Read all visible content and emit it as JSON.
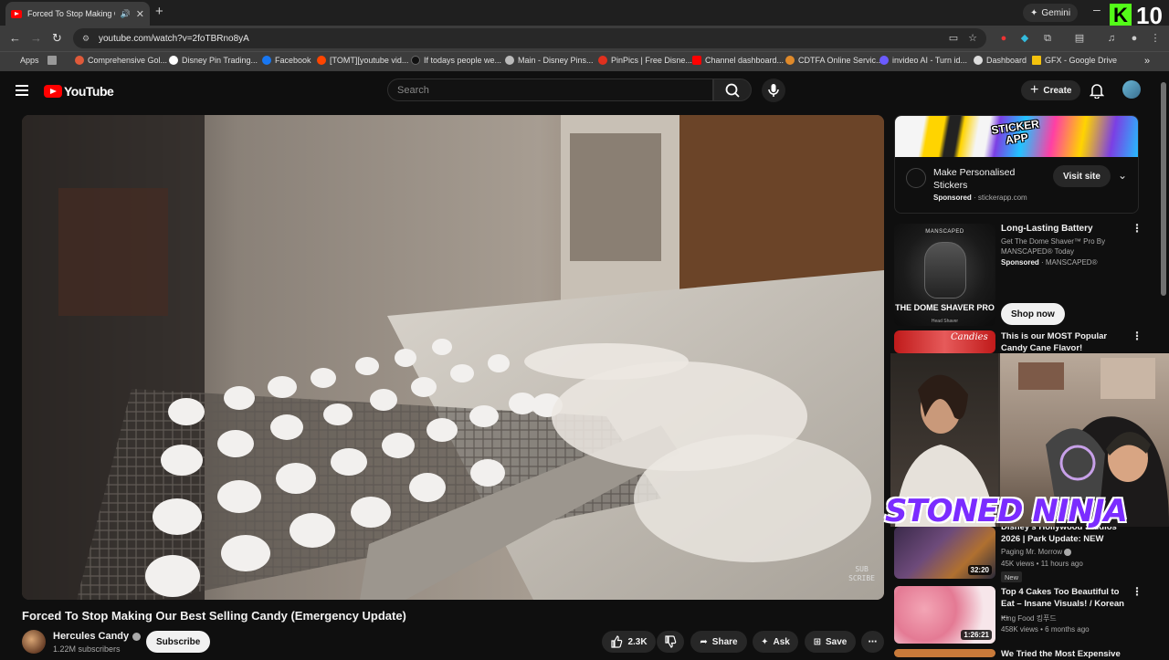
{
  "browser": {
    "tab_title": "Forced To Stop Making Our",
    "url": "youtube.com/watch?v=2foTBRno8yA",
    "gemini_label": "Gemini",
    "kick_count": "10",
    "bookmarks": [
      {
        "label": "Apps",
        "color": "#888888"
      },
      {
        "label": "",
        "color": "#888888"
      },
      {
        "label": "Comprehensive Gol...",
        "color": "#e05a3a"
      },
      {
        "label": "Disney Pin Trading...",
        "color": "#ffffff"
      },
      {
        "label": "Facebook",
        "color": "#1877f2"
      },
      {
        "label": "[TOMT][youtube vid...",
        "color": "#ff4500"
      },
      {
        "label": "If todays people we...",
        "color": "#111111"
      },
      {
        "label": "Main - Disney Pins...",
        "color": "#bbbbbb"
      },
      {
        "label": "PinPics | Free Disne...",
        "color": "#e0301e"
      },
      {
        "label": "Channel dashboard...",
        "color": "#ff0000"
      },
      {
        "label": "CDTFA Online Servic...",
        "color": "#e08a2a"
      },
      {
        "label": "invideo AI - Turn id...",
        "color": "#6b5bff"
      },
      {
        "label": "Dashboard",
        "color": "#dddddd"
      },
      {
        "label": "GFX - Google Drive",
        "color": "#f4c20d"
      }
    ]
  },
  "youtube": {
    "logo_text": "YouTube",
    "search_placeholder": "Search",
    "create_label": "Create"
  },
  "video": {
    "title": "Forced To Stop Making Our Best Selling Candy (Emergency Update)",
    "watermark": "SUB\nSCRIBE",
    "channel": "Hercules Candy",
    "subscribers": "1.22M subscribers",
    "subscribe_label": "Subscribe",
    "likes": "2.3K",
    "share_label": "Share",
    "ask_label": "Ask",
    "save_label": "Save"
  },
  "sidebar": {
    "ad1": {
      "banner_text": "STICKER APP",
      "title": "Make Personalised Stickers",
      "sponsored": "Sponsored",
      "domain": "stickerapp.com",
      "visit_label": "Visit site"
    },
    "ad2": {
      "brand": "MANSCAPED",
      "caption": "THE DOME SHAVER PRO",
      "caption_sub": "Head Shaver",
      "title": "Long-Lasting Battery",
      "desc": "Get The Dome Shaver™ Pro By MANSCAPED® Today",
      "sponsored": "Sponsored",
      "advertiser": "MANSCAPED®",
      "shop_label": "Shop now"
    },
    "recs": [
      {
        "title": "This is our MOST Popular Candy Cane Flavor!",
        "channel": "",
        "meta": "",
        "duration": "",
        "thumb_label": "Candies"
      },
      {
        "title": "Disney's Hollywood Studios 2026 | Park Update: NEW Spri...",
        "channel": "Paging Mr. Morrow",
        "meta": "45K views • 11 hours ago",
        "duration": "32:20",
        "badge": "New"
      },
      {
        "title": "Top 4 Cakes Too Beautiful to Eat – Insane Visuals! / Korean ...",
        "channel": "King Food 킹푸드",
        "meta": "458K views • 6 months ago",
        "duration": "1:26:21"
      },
      {
        "title": "We Tried the Most Expensive",
        "channel": "",
        "meta": "",
        "duration": ""
      }
    ]
  },
  "overlay": {
    "stream_name": "STONED NINJA"
  }
}
